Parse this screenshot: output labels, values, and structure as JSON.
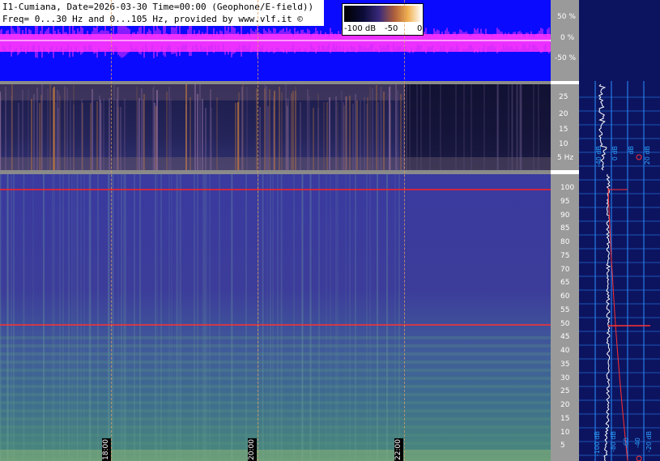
{
  "header": {
    "line1": "I1-Cumiana, Date=2026-03-30 Time=00:00 (Geophone/E-field))",
    "line2": "Freq= 0...30 Hz and 0...105 Hz, provided by www.vlf.it ©"
  },
  "colorbar": {
    "labels": [
      "-100 dB",
      "-50",
      "0"
    ]
  },
  "waveform_scale": {
    "ticks": [
      "50 %",
      "0 %",
      "-50 %"
    ]
  },
  "spectrogram_top_scale": {
    "ticks": [
      "25",
      "20",
      "15",
      "10",
      "5 Hz"
    ]
  },
  "spectrogram_bottom_scale": {
    "ticks": [
      "100",
      "95",
      "90",
      "85",
      "80",
      "75",
      "70",
      "65",
      "60",
      "55",
      "50",
      "45",
      "40",
      "35",
      "30",
      "25",
      "20",
      "15",
      "10",
      "5"
    ]
  },
  "time_markers": [
    "18:00",
    "20:00",
    "22:00"
  ],
  "profile_panel": {
    "top_labels": [
      "-40 dB",
      "0 dB",
      "dB",
      "20 dB"
    ],
    "bottom_labels": [
      "-100 dB",
      "-80 dB",
      "-60",
      "-40",
      "-20 dB"
    ]
  },
  "colors": {
    "waveform_bg": "#0a0aff",
    "waveform_trace": "#ff33ff",
    "line_red": "#ff2020",
    "profile_bg": "#0c1460",
    "profile_grid": "#2a90ff",
    "scale_bg": "#9a9a9a"
  }
}
